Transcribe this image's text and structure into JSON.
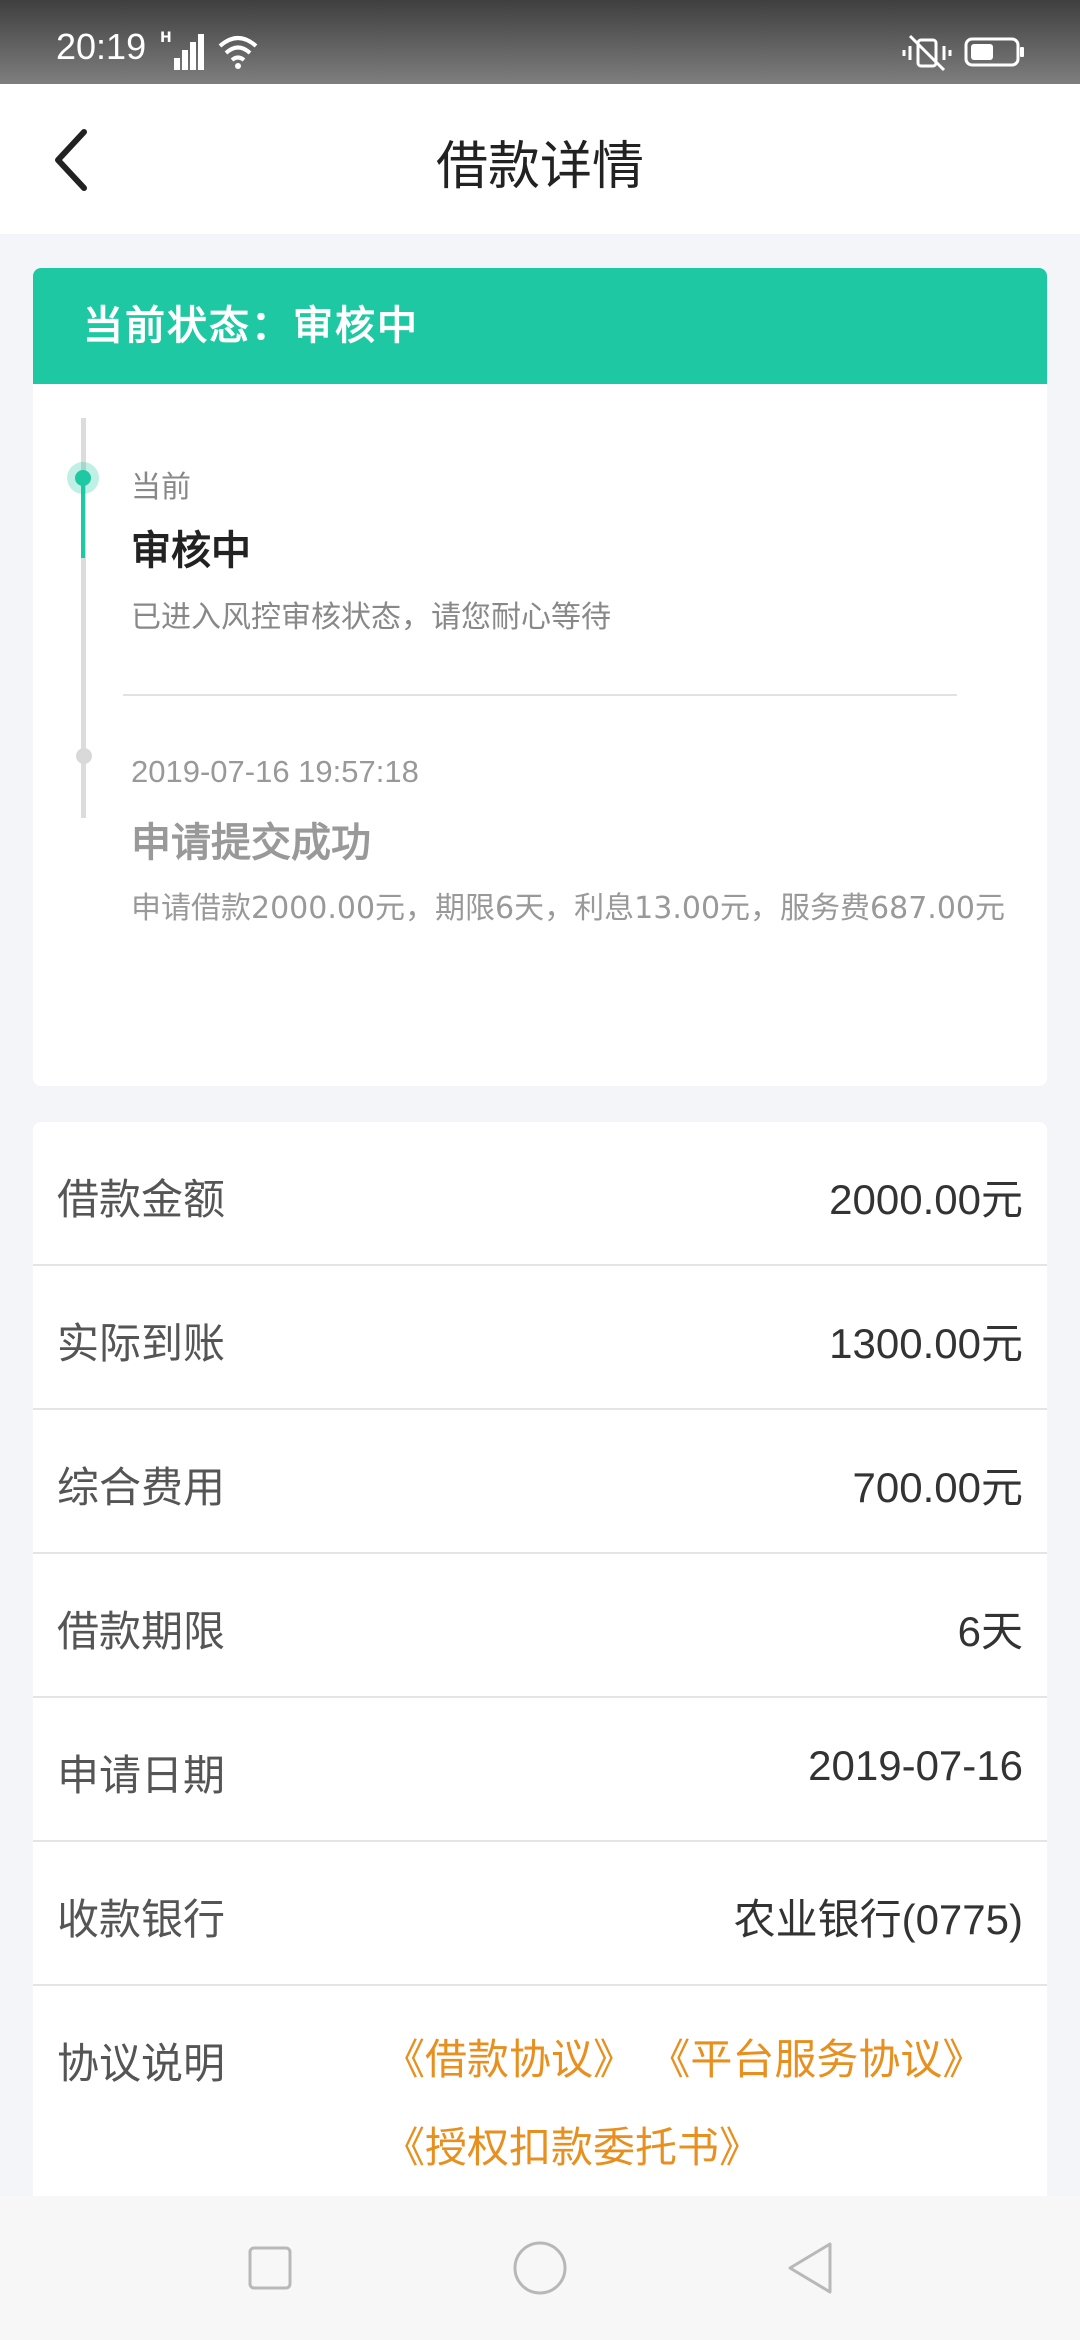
{
  "status_bar": {
    "time": "20:19",
    "signal_label": "H",
    "icons": [
      "signal-icon",
      "wifi-icon",
      "mute-icon",
      "battery-icon"
    ]
  },
  "nav": {
    "title": "借款详情",
    "back_icon": "chevron-left-icon"
  },
  "status_card": {
    "header": "当前状态：审核中",
    "timeline": [
      {
        "tag": "当前",
        "title": "审核中",
        "desc": "已进入风控审核状态，请您耐心等待"
      },
      {
        "time": "2019-07-16 19:57:18",
        "title": "申请提交成功",
        "desc": "申请借款2000.00元，期限6天，利息13.00元，服务费687.00元"
      }
    ]
  },
  "details": {
    "rows": [
      {
        "label": "借款金额",
        "value": "2000.00元"
      },
      {
        "label": "实际到账",
        "value": "1300.00元"
      },
      {
        "label": "综合费用",
        "value": "700.00元"
      },
      {
        "label": "借款期限",
        "value": "6天"
      },
      {
        "label": "申请日期",
        "value": "2019-07-16"
      },
      {
        "label": "收款银行",
        "value": "农业银行(0775)"
      }
    ],
    "agreement": {
      "label": "协议说明",
      "links": [
        "《借款协议》",
        "《平台服务协议》",
        "《授权扣款委托书》"
      ]
    }
  },
  "colors": {
    "accent": "#1ec8a2",
    "link": "#e8901f"
  },
  "bottom_nav": {
    "icons": [
      "square-icon",
      "circle-icon",
      "triangle-back-icon"
    ]
  }
}
